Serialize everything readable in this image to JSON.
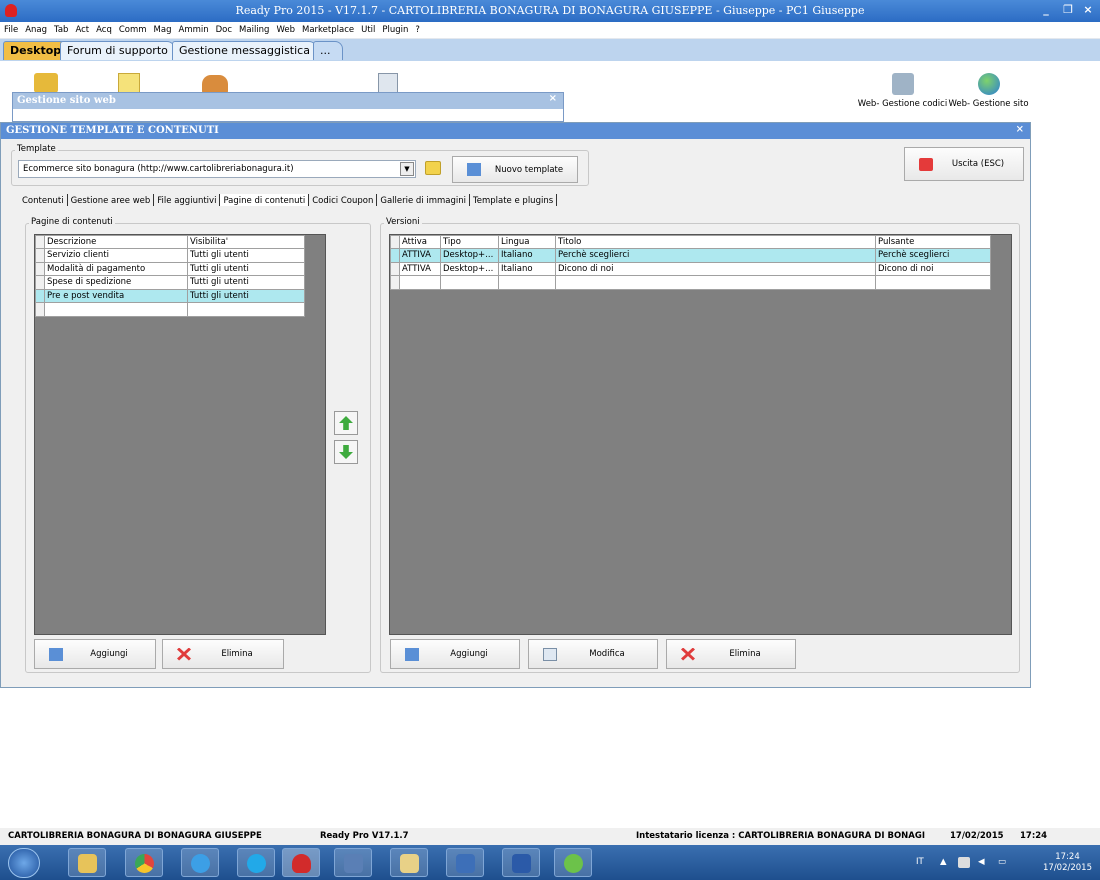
{
  "window": {
    "title": "Ready Pro 2015 - V17.1.7 - CARTOLIBRERIA BONAGURA DI BONAGURA GIUSEPPE - Giuseppe - PC1 Giuseppe"
  },
  "menu": [
    "File",
    "Anag",
    "Tab",
    "Act",
    "Acq",
    "Comm",
    "Mag",
    "Ammin",
    "Doc",
    "Mailing",
    "Web",
    "Marketplace",
    "Util",
    "Plugin",
    "?"
  ],
  "tabs": [
    "Desktop",
    "Forum di supporto",
    "Gestione messaggistica",
    "..."
  ],
  "desktop_icons": [
    {
      "label": "Web- Gestione codici"
    },
    {
      "label": "Web- Gestione sito"
    }
  ],
  "sito_web": {
    "title": "Gestione sito web",
    "close": "×"
  },
  "dialog": {
    "title": "GESTIONE TEMPLATE E CONTENUTI",
    "close": "×",
    "template_group": "Template",
    "template_value": "Ecommerce sito bonagura (http://www.cartolibreriabonagura.it)",
    "new_template": "Nuovo template",
    "exit": "Uscita (ESC)",
    "subtabs": [
      "Contenuti",
      "Gestione aree web",
      "File aggiuntivi",
      "Pagine di contenuti",
      "Codici Coupon",
      "Gallerie di immagini",
      "Template e plugins"
    ],
    "active_subtab": "Pagine di contenuti",
    "pages_group": "Pagine di contenuti",
    "pages_headers": [
      "Descrizione",
      "Visibilita'"
    ],
    "pages_rows": [
      [
        "Servizio clienti",
        "Tutti gli utenti"
      ],
      [
        "Modalità di pagamento",
        "Tutti gli utenti"
      ],
      [
        "Spese di spedizione",
        "Tutti gli utenti"
      ],
      [
        "Pre e post vendita",
        "Tutti gli utenti"
      ],
      [
        "",
        ""
      ]
    ],
    "versions_group": "Versioni",
    "versions_headers": [
      "Attiva",
      "Tipo",
      "Lingua",
      "Titolo",
      "Pulsante"
    ],
    "versions_rows": [
      [
        "ATTIVA",
        "Desktop+...",
        "Italiano",
        "Perchè sceglierci",
        "Perchè sceglierci"
      ],
      [
        "ATTIVA",
        "Desktop+...",
        "Italiano",
        "Dicono di noi",
        "Dicono di noi"
      ],
      [
        "",
        "",
        "",
        "",
        ""
      ]
    ],
    "btn_add": "Aggiungi",
    "btn_delete": "Elimina",
    "btn_edit": "Modifica"
  },
  "status": {
    "company": "CARTOLIBRERIA BONAGURA DI BONAGURA GIUSEPPE",
    "version": "Ready Pro V17.1.7",
    "license": "Intestatario licenza : CARTOLIBRERIA BONAGURA DI BONAGI",
    "date": "17/02/2015",
    "time": "17:24"
  },
  "taskbar": {
    "lang": "IT",
    "clock_time": "17:24",
    "clock_date": "17/02/2015"
  },
  "colors": {
    "titlebar": "#2c6cc4",
    "selected_row": "#aee8ef",
    "active_tab": "#f1be45"
  }
}
